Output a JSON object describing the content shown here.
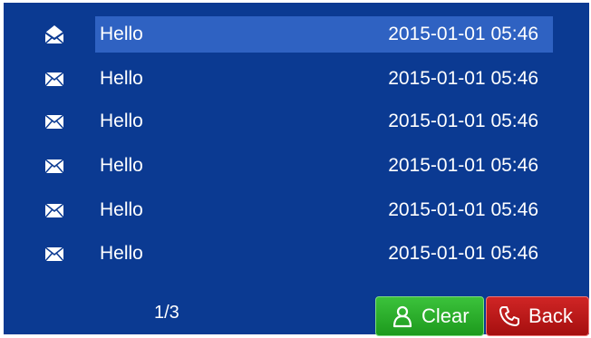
{
  "messages": [
    {
      "subject": "Hello",
      "date": "2015-01-01 05:46",
      "icon": "envelope-open-icon",
      "selected": true
    },
    {
      "subject": "Hello",
      "date": "2015-01-01 05:46",
      "icon": "envelope-icon",
      "selected": false
    },
    {
      "subject": "Hello",
      "date": "2015-01-01 05:46",
      "icon": "envelope-icon",
      "selected": false
    },
    {
      "subject": "Hello",
      "date": "2015-01-01 05:46",
      "icon": "envelope-icon",
      "selected": false
    },
    {
      "subject": "Hello",
      "date": "2015-01-01 05:46",
      "icon": "envelope-icon",
      "selected": false
    },
    {
      "subject": "Hello",
      "date": "2015-01-01 05:46",
      "icon": "envelope-icon",
      "selected": false
    }
  ],
  "pager": {
    "text": "1/3"
  },
  "buttons": {
    "clear_label": "Clear",
    "clear_icon": "person-icon",
    "back_label": "Back",
    "back_icon": "phone-icon"
  },
  "colors": {
    "background": "#0b3a92",
    "selected_row": "#2f62c2",
    "clear_button": "#26ad26",
    "back_button": "#c01b1b",
    "text": "#ffffff"
  }
}
